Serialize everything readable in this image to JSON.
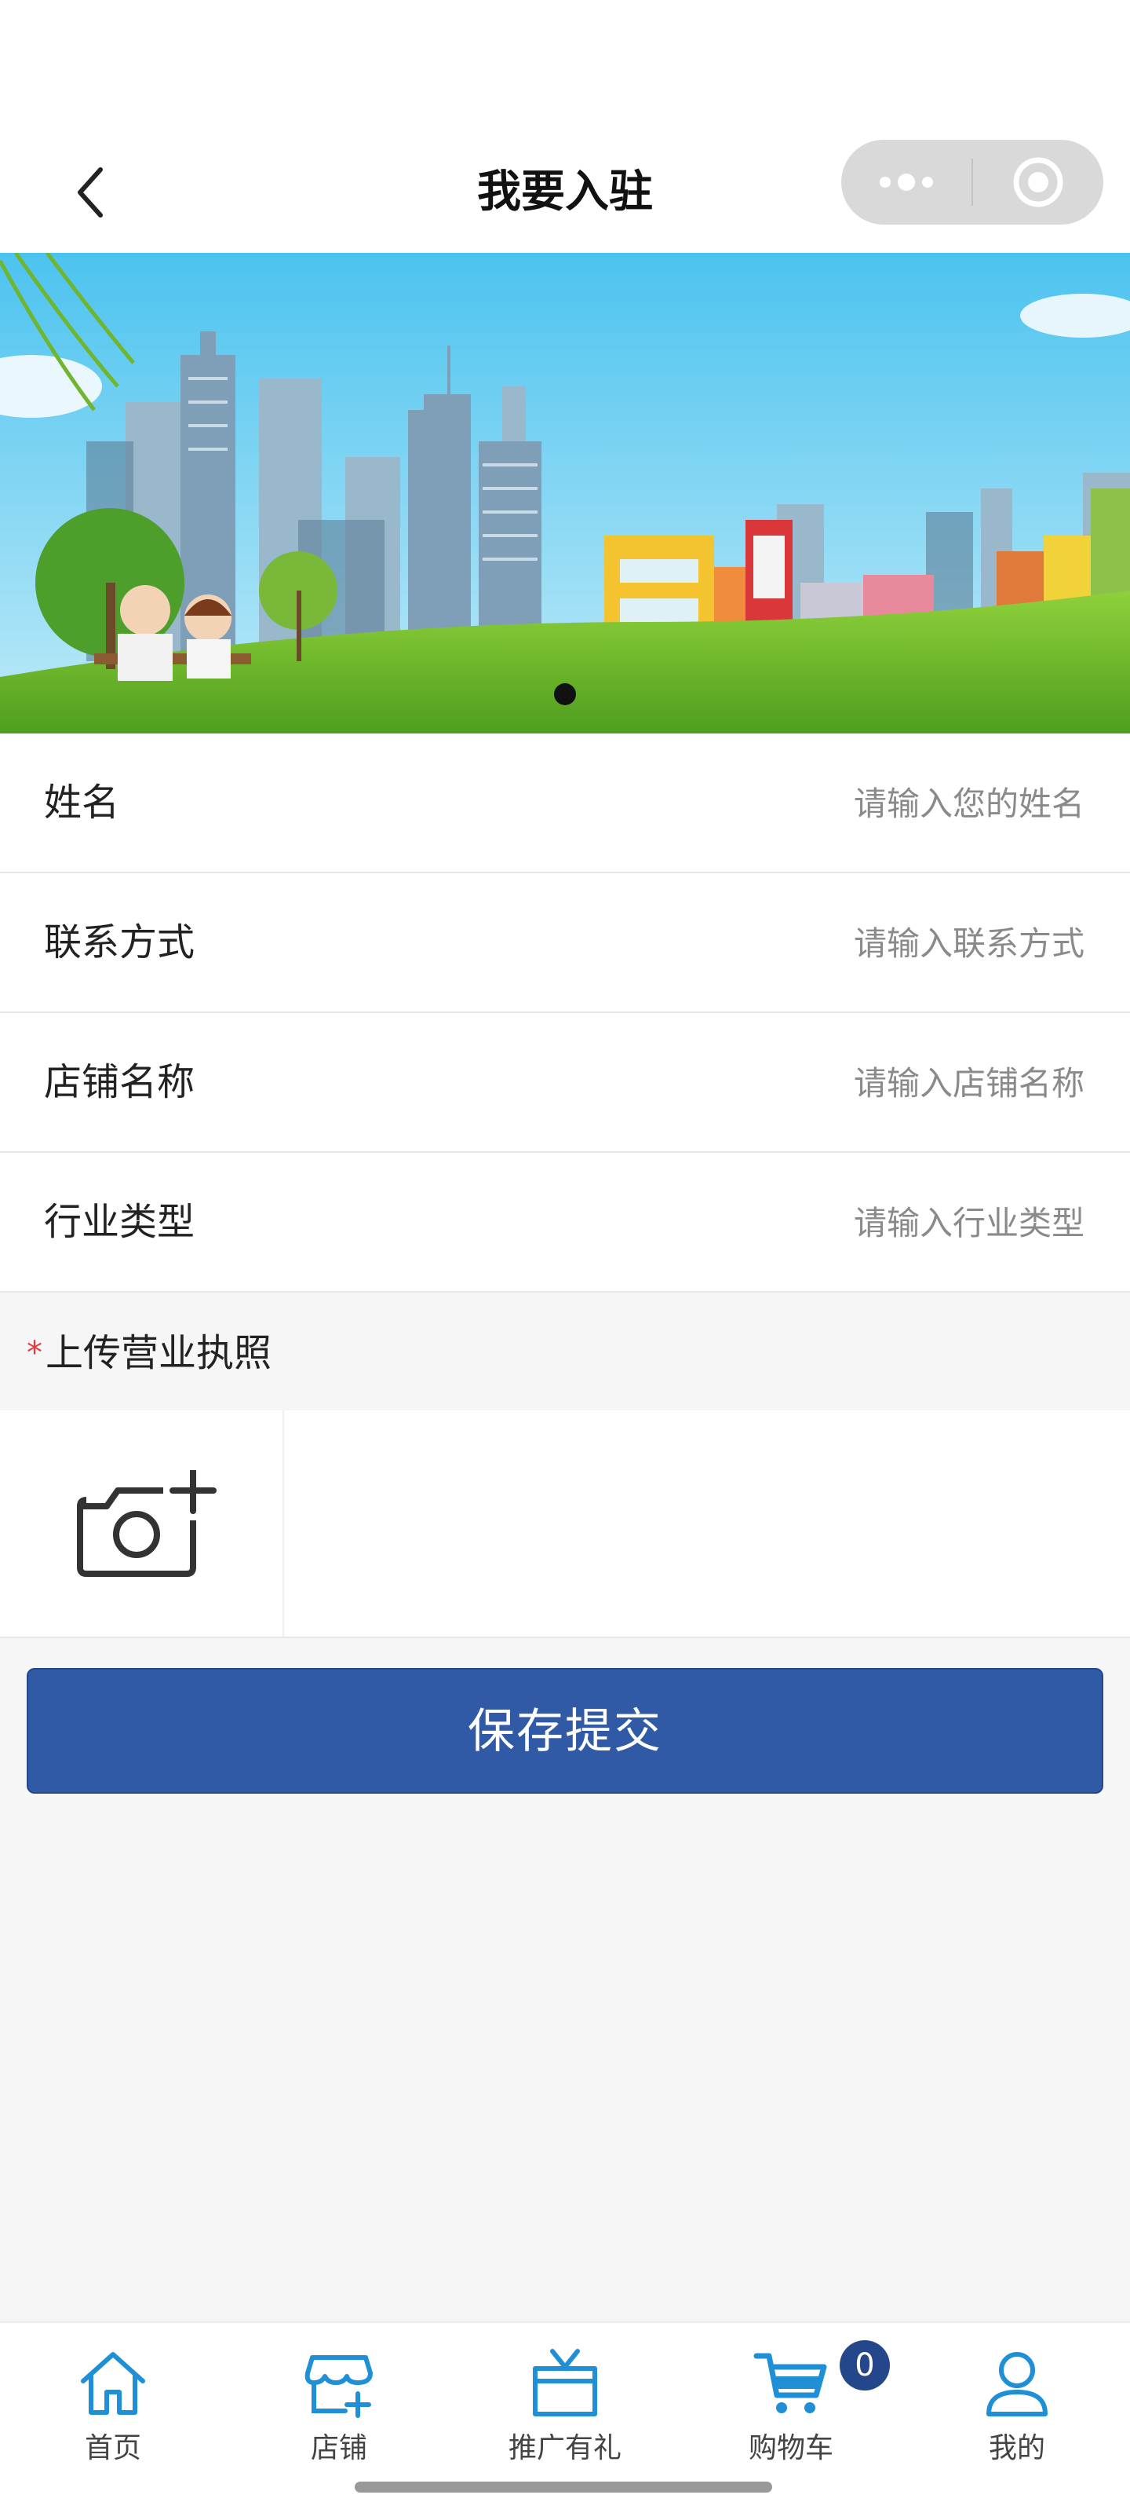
{
  "header": {
    "title": "我要入驻",
    "back_icon": "chevron-left-icon",
    "more_icon": "more-dots-icon",
    "close_icon": "target-close-icon"
  },
  "banner": {
    "pagination": {
      "count": 1,
      "active": 0
    }
  },
  "form": {
    "fields": [
      {
        "label": "姓名",
        "placeholder": "请输入您的姓名",
        "value": ""
      },
      {
        "label": "联系方式",
        "placeholder": "请输入联系方式",
        "value": ""
      },
      {
        "label": "店铺名称",
        "placeholder": "请输入店铺名称",
        "value": ""
      },
      {
        "label": "行业类型",
        "placeholder": "请输入行业类型",
        "value": ""
      }
    ],
    "upload": {
      "required_mark": "*",
      "title": "上传营业执照",
      "icon": "camera-add-icon"
    },
    "submit_label": "保存提交"
  },
  "tabbar": {
    "items": [
      {
        "label": "首页",
        "icon": "home-icon"
      },
      {
        "label": "店铺",
        "icon": "store-icon"
      },
      {
        "label": "推广有礼",
        "icon": "gift-icon"
      },
      {
        "label": "购物车",
        "icon": "cart-icon",
        "badge": "0"
      },
      {
        "label": "我的",
        "icon": "user-icon"
      }
    ]
  },
  "colors": {
    "primary": "#3059a6",
    "tab_icon": "#1f8fd6",
    "required": "#e23c3c",
    "badge": "#24478c"
  }
}
